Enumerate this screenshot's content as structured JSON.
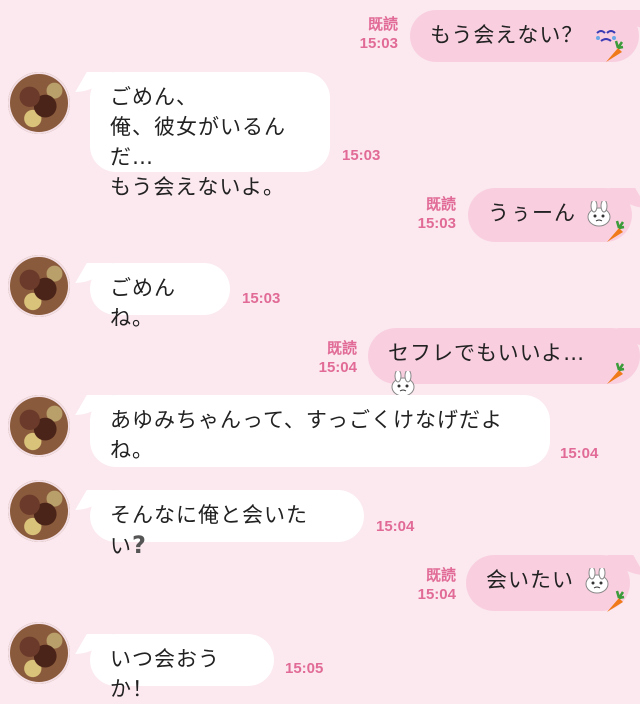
{
  "colors": {
    "background": "#fbe9ef",
    "bubble_right": "#f9cfe0",
    "bubble_left": "#ffffff",
    "accent": "#e16b96"
  },
  "messages": [
    {
      "side": "right",
      "text": "もう会えない？",
      "read": "既読",
      "time": "15:03",
      "icon": "crying-face-icon"
    },
    {
      "side": "left",
      "lines": [
        "ごめん、",
        "俺、彼女がいるんだ…",
        "もう会えないよ。"
      ],
      "time": "15:03"
    },
    {
      "side": "right",
      "text": "うぅーん",
      "read": "既読",
      "time": "15:03",
      "icon": "bunny-sticker-icon"
    },
    {
      "side": "left",
      "lines": [
        "ごめんね。"
      ],
      "time": "15:03"
    },
    {
      "side": "right",
      "text": "セフレでもいいよ…",
      "read": "既読",
      "time": "15:04",
      "icon": "bunny-sticker-icon"
    },
    {
      "side": "left",
      "lines": [
        "あゆみちゃんって、すっごくけなげだよ",
        "ね。"
      ],
      "time": "15:04"
    },
    {
      "side": "left",
      "text": "そんなに俺と会いたい",
      "qmark": "?",
      "time": "15:04"
    },
    {
      "side": "right",
      "text": "会いたい",
      "read": "既読",
      "time": "15:04",
      "icon": "bunny-sticker-icon"
    },
    {
      "side": "left",
      "lines": [
        "いつ会おうか！"
      ],
      "time": "15:05"
    }
  ]
}
